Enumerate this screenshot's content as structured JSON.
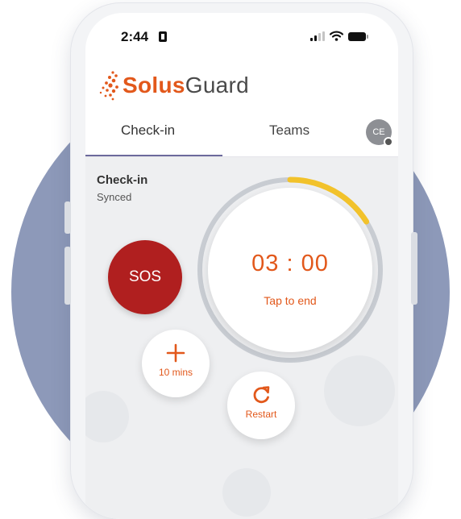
{
  "status_bar": {
    "time": "2:44",
    "icons": [
      "sim-card-icon",
      "signal-icon",
      "wifi-icon",
      "battery-icon"
    ]
  },
  "app": {
    "logo_part1": "Solus",
    "logo_part2": "Guard",
    "colors": {
      "accent": "#e2581b",
      "sos": "#b01f1f",
      "ring": "#c8ccd2",
      "progress": "#f2c22b",
      "tab_indicator": "#6c6a9c"
    }
  },
  "tabs": [
    {
      "label": "Check-in",
      "active": true
    },
    {
      "label": "Teams",
      "active": false
    }
  ],
  "user": {
    "initials": "CE"
  },
  "checkin": {
    "title": "Check-in",
    "status": "Synced",
    "sos_label": "SOS",
    "timer": "03 : 00",
    "timer_hint": "Tap to end",
    "progress_fraction": 0.16,
    "add_label": "10 mins",
    "restart_label": "Restart"
  }
}
